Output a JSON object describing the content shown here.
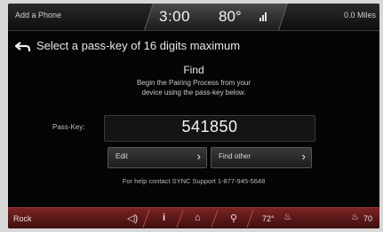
{
  "topbar": {
    "title": "Add a Phone",
    "time": "3:00",
    "temperature": "80°",
    "range": "0.0 Miles"
  },
  "main": {
    "heading": "Select a pass-key of 16 digits maximum",
    "find_title": "Find",
    "find_line1": "Begin the Pairing Process from your",
    "find_line2": "device using the pass-key below.",
    "passkey_label": "Pass-Key:",
    "passkey_value": "541850",
    "edit_label": "Edit",
    "find_other_label": "Find other",
    "help_text": "For help contact SYNC Support 1-877-945-5648"
  },
  "bottombar": {
    "source": "Rock",
    "driver_temp": "72°",
    "passenger_temp": "70"
  },
  "colors": {
    "accent_bottom": "#7a2323",
    "screen_bg": "#050505"
  }
}
